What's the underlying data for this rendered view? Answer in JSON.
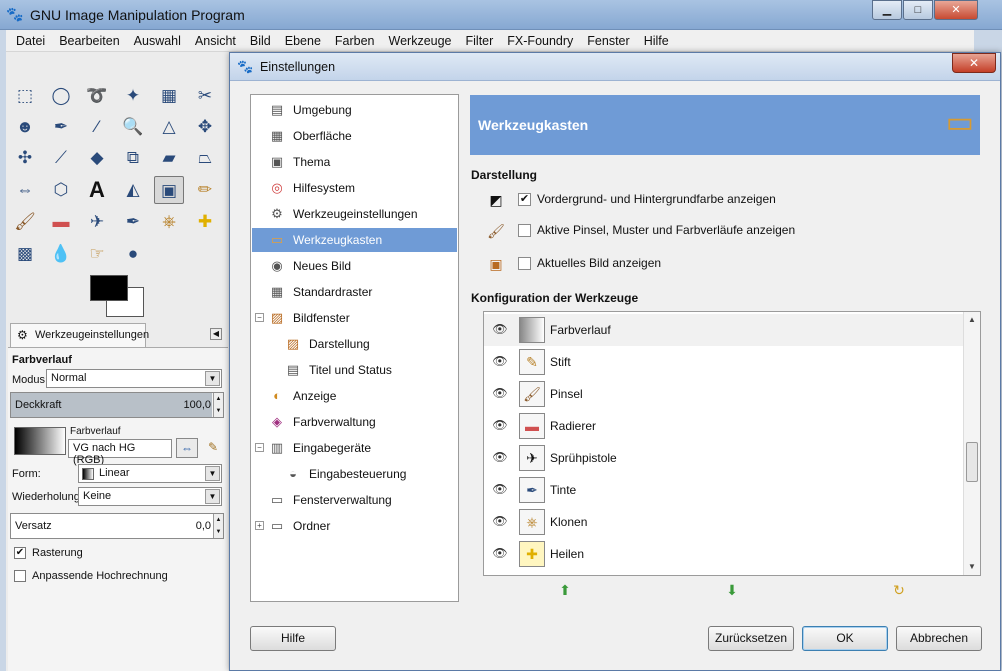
{
  "main": {
    "title": "GNU Image Manipulation Program",
    "window_buttons": [
      "▁",
      "□",
      "✕"
    ],
    "menu": [
      "Datei",
      "Bearbeiten",
      "Auswahl",
      "Ansicht",
      "Bild",
      "Ebene",
      "Farben",
      "Werkzeuge",
      "Filter",
      "FX-Foundry",
      "Fenster",
      "Hilfe"
    ]
  },
  "toolbox": {
    "tab_label": "Werkzeugeinstellungen",
    "options": {
      "title": "Farbverlauf",
      "modus_label": "Modus:",
      "modus_value": "Normal",
      "deckkraft_label": "Deckkraft",
      "deckkraft_value": "100,0",
      "gradient_label": "Farbverlauf",
      "gradient_value": "VG nach HG (RGB)",
      "form_label": "Form:",
      "form_value": "Linear",
      "wiederholung_label": "Wiederholung:",
      "wiederholung_value": "Keine",
      "versatz_label": "Versatz",
      "versatz_value": "0,0",
      "rasterung_label": "Rasterung",
      "rasterung_checked": true,
      "anpassende_label": "Anpassende Hochrechnung",
      "anpassende_checked": false
    }
  },
  "dialog": {
    "title": "Einstellungen",
    "close": "✕",
    "nav": [
      {
        "label": "Umgebung",
        "icon": "memory-icon",
        "glyph": "▤"
      },
      {
        "label": "Oberfläche",
        "icon": "interface-icon",
        "glyph": "▦"
      },
      {
        "label": "Thema",
        "icon": "theme-icon",
        "glyph": "▣"
      },
      {
        "label": "Hilfesystem",
        "icon": "lifebuoy-icon",
        "glyph": "◎"
      },
      {
        "label": "Werkzeugeinstellungen",
        "icon": "tool-options-icon",
        "glyph": "⚙"
      },
      {
        "label": "Werkzeugkasten",
        "icon": "toolbox-icon",
        "glyph": "▭"
      },
      {
        "label": "Neues Bild",
        "icon": "new-image-icon",
        "glyph": "◉"
      },
      {
        "label": "Standardraster",
        "icon": "grid-icon",
        "glyph": "▦"
      },
      {
        "label": "Bildfenster",
        "icon": "image-window-icon",
        "glyph": "▨"
      },
      {
        "label": "Darstellung",
        "icon": "appearance-icon",
        "glyph": "▨"
      },
      {
        "label": "Titel und Status",
        "icon": "title-status-icon",
        "glyph": "▤"
      },
      {
        "label": "Anzeige",
        "icon": "display-icon",
        "glyph": "◐"
      },
      {
        "label": "Farbverwaltung",
        "icon": "color-management-icon",
        "glyph": "◈"
      },
      {
        "label": "Eingabegeräte",
        "icon": "input-devices-icon",
        "glyph": "▥"
      },
      {
        "label": "Eingabesteuerung",
        "icon": "input-controllers-icon",
        "glyph": "◒"
      },
      {
        "label": "Fensterverwaltung",
        "icon": "window-management-icon",
        "glyph": "▭"
      },
      {
        "label": "Ordner",
        "icon": "folders-icon",
        "glyph": "▭"
      }
    ],
    "selected_nav_index": 5,
    "header": "Werkzeugkasten",
    "section_darstellung": "Darstellung",
    "options": [
      {
        "label": "Vordergrund- und Hintergrundfarbe anzeigen",
        "checked": true,
        "icon": "fg-bg-color-icon"
      },
      {
        "label": "Aktive Pinsel, Muster und Farbverläufe anzeigen",
        "checked": false,
        "icon": "brush-icon"
      },
      {
        "label": "Aktuelles Bild anzeigen",
        "checked": false,
        "icon": "image-icon"
      }
    ],
    "section_config": "Konfiguration der Werkzeuge",
    "tools": [
      {
        "name": "Farbverlauf",
        "icon": "gradient-tool-icon",
        "glyph": "▤"
      },
      {
        "name": "Stift",
        "icon": "pencil-tool-icon",
        "glyph": "✎"
      },
      {
        "name": "Pinsel",
        "icon": "paintbrush-tool-icon",
        "glyph": "🖌"
      },
      {
        "name": "Radierer",
        "icon": "eraser-tool-icon",
        "glyph": "▬"
      },
      {
        "name": "Sprühpistole",
        "icon": "airbrush-tool-icon",
        "glyph": "✈"
      },
      {
        "name": "Tinte",
        "icon": "ink-tool-icon",
        "glyph": "✒"
      },
      {
        "name": "Klonen",
        "icon": "clone-tool-icon",
        "glyph": "⎈"
      },
      {
        "name": "Heilen",
        "icon": "heal-tool-icon",
        "glyph": "✚"
      }
    ],
    "buttons": {
      "help": "Hilfe",
      "reset": "Zurücksetzen",
      "ok": "OK",
      "cancel": "Abbrechen"
    },
    "colors": {
      "selection": "#6f9bd6",
      "header_bg": "#6f9bd6"
    }
  }
}
